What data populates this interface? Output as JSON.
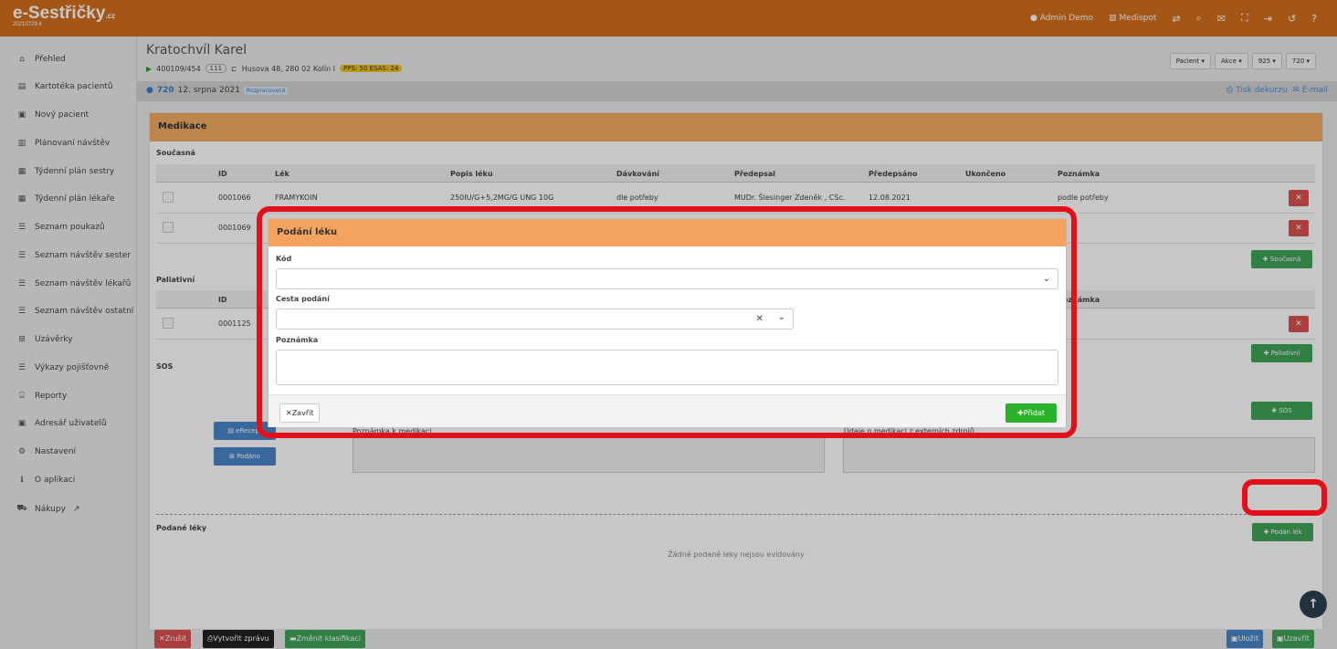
{
  "app": {
    "brand": "e-Sestřičky",
    "brand_suffix": ".cz",
    "version": "20210729.4"
  },
  "topnav": {
    "user": "Admin Demo",
    "org": "Medispot",
    "icons": [
      "exchange-icon",
      "search-icon",
      "envelope-icon",
      "fullscreen-icon",
      "logout-icon",
      "history-icon",
      "help-icon"
    ]
  },
  "sidebar": {
    "items": [
      {
        "icon": "⌂",
        "label": "Přehled"
      },
      {
        "icon": "▤",
        "label": "Kartotéka pacientů"
      },
      {
        "icon": "▣",
        "label": "Nový pacient"
      },
      {
        "icon": "▥",
        "label": "Plánovaní návštěv"
      },
      {
        "icon": "▦",
        "label": "Týdenní plán sestry"
      },
      {
        "icon": "▦",
        "label": "Týdenní plán lékaře"
      },
      {
        "icon": "☰",
        "label": "Seznam poukazů"
      },
      {
        "icon": "☰",
        "label": "Seznam návštěv sester"
      },
      {
        "icon": "☰",
        "label": "Seznam návštěv lékařů"
      },
      {
        "icon": "☰",
        "label": "Seznam návštěv ostatní"
      },
      {
        "icon": "⊞",
        "label": "Uzávěrky"
      },
      {
        "icon": "☰",
        "label": "Výkazy pojišťovně"
      },
      {
        "icon": "⌸",
        "label": "Reporty"
      },
      {
        "icon": "▣",
        "label": "Adresář uživatelů"
      },
      {
        "icon": "⚙",
        "label": "Nastavení"
      },
      {
        "icon": "ℹ",
        "label": "O aplikaci"
      },
      {
        "icon": "⛟",
        "label": "Nákupy"
      }
    ]
  },
  "patient": {
    "name": "Kratochvíl Karel",
    "id": "400109/454",
    "insurance": "111",
    "address": "Husova 48, 280 02 Kolín I",
    "pps": "PPS: 50 ESAS: 24",
    "actions": [
      "Pacient",
      "Akce",
      "925",
      "720"
    ]
  },
  "visit": {
    "code": "720",
    "date": "12. srpna 2021",
    "state": "Rozpracovaná",
    "print": "Tisk dekurzu",
    "email": "E-mail"
  },
  "panel": {
    "title": "Medikace"
  },
  "current": {
    "label": "Současná",
    "headers": [
      "ID",
      "Lék",
      "Popis léku",
      "Dávkování",
      "Předepsal",
      "Předepsáno",
      "Ukončeno",
      "Poznámka"
    ],
    "rows": [
      {
        "id": "0001066",
        "drug": "FRAMYKOIN",
        "desc": "250IU/G+5,2MG/G UNG 10G",
        "dose": "dle potřeby",
        "by": "MUDr. Šlesinger Zdeněk , CSc.",
        "date": "12.08.2021",
        "note": "podle potřeby"
      },
      {
        "id": "0001069"
      }
    ],
    "add_button": "Současná"
  },
  "palliative": {
    "label": "Paliativní",
    "headers": [
      "ID",
      "Poznámka"
    ],
    "rows": [
      {
        "id": "0001125"
      }
    ],
    "add_button": "Paliativní"
  },
  "sos": {
    "label": "SOS",
    "add_button": "SOS",
    "erecept": "eRecept",
    "given": "Podáno",
    "note_label": "Poznámka k medikaci",
    "ext_label": "Údaje o medikaci z externích zdrojů"
  },
  "given_drugs": {
    "label": "Podané léky",
    "empty": "Žádné podané leky nejsou evidovány",
    "add_button": "Podán lék"
  },
  "footer": {
    "cancel": "Zrušit",
    "report": "Vytvořit zprávu",
    "reclass": "Změnit klasifikaci",
    "save": "Uložit",
    "close": "Uzavřít"
  },
  "modal": {
    "title": "Podání léku",
    "code_label": "Kód",
    "route_label": "Cesta podání",
    "note_label": "Poznámka",
    "close_button": "Zavřít",
    "add_button": "Přidat"
  },
  "colors": {
    "topbar": "#d26f1e",
    "panel_header": "#f2ab64",
    "highlight": "#e3101c",
    "success": "#3fa358",
    "danger": "#d9534f"
  }
}
